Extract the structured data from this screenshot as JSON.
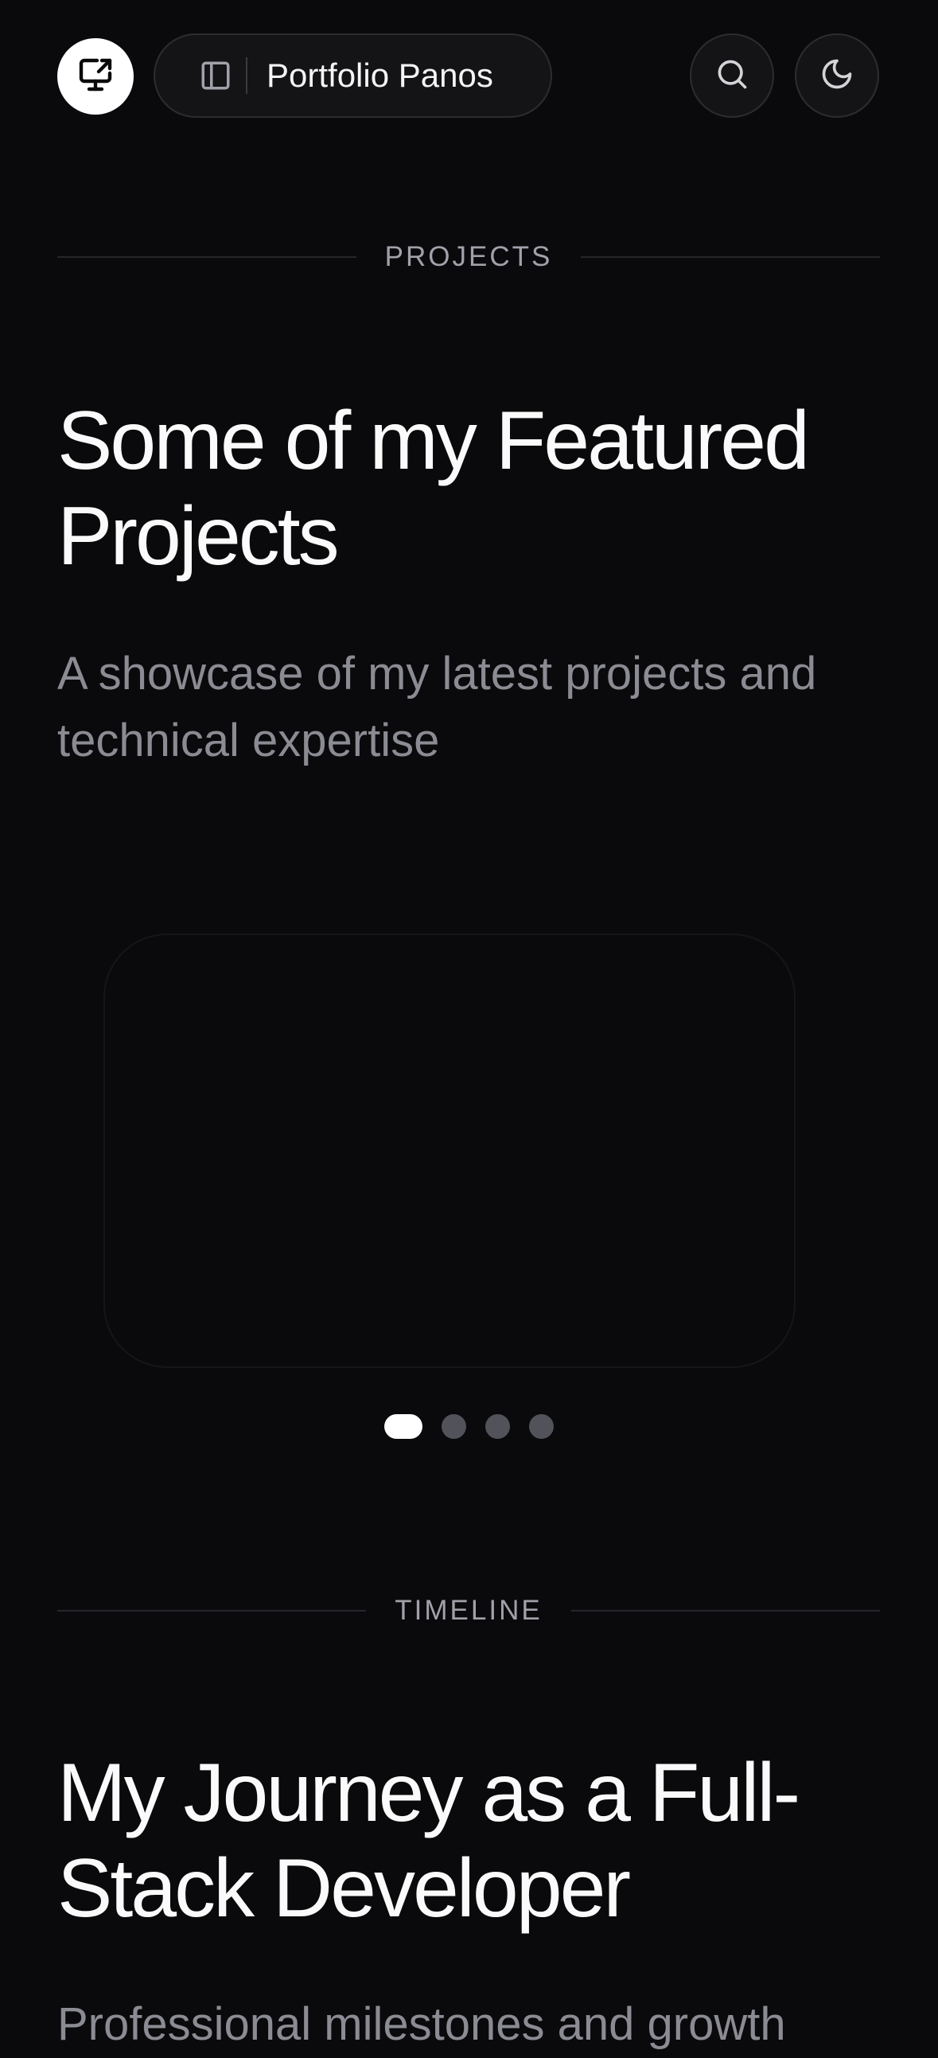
{
  "header": {
    "logo_icon": "monitor-arrow-icon",
    "sidebar_toggle_icon": "sidebar-panel-icon",
    "title": "Portfolio Panos",
    "search_icon": "search-icon",
    "theme_icon": "moon-icon"
  },
  "projects_section": {
    "eyebrow": "PROJECTS",
    "title": "Some of my Featured Projects",
    "subtitle": "A showcase of my latest projects and technical expertise",
    "carousel": {
      "slide_count": 4,
      "active_index": 0
    }
  },
  "timeline_section": {
    "eyebrow": "TIMELINE",
    "title": "My Journey as a Full-Stack Developer",
    "subtitle": "Professional milestones and growth"
  },
  "colors": {
    "background": "#0a0a0c",
    "text_primary": "#fafafa",
    "text_muted": "#8b8b93",
    "border": "#2c2c31"
  }
}
